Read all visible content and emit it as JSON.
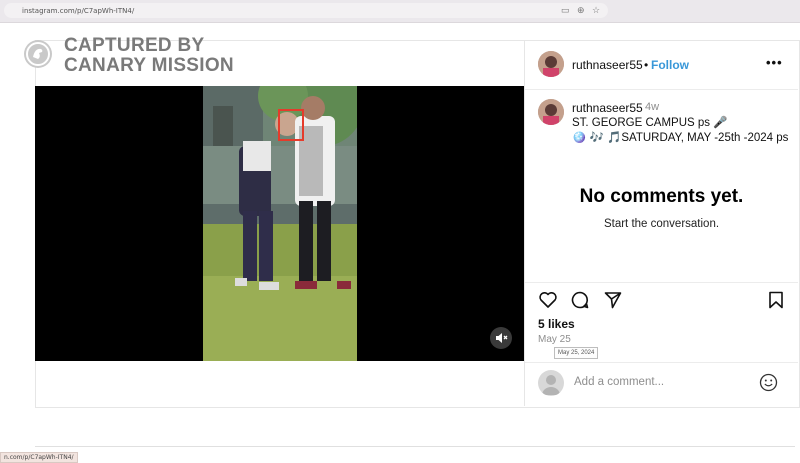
{
  "browser": {
    "url": "instagram.com/p/C7apWh-ITN4/",
    "status_url": "n.com/p/C7apWh-ITN4/"
  },
  "watermark": {
    "text": "CAPTURED BY\nCANARY MISSION"
  },
  "post": {
    "username": "ruthnaseer55",
    "separator": "•",
    "follow_label": "Follow",
    "more_label": "•••",
    "caption": {
      "username": "ruthnaseer55",
      "age": "4w",
      "line1": "ST. GEORGE CAMPUS ps 🎤",
      "line2": "🪩 🎶 🎵SATURDAY, MAY -25th -2024 ps"
    },
    "comments": {
      "empty_title": "No comments yet.",
      "empty_subtitle": "Start the conversation."
    },
    "likes": "5 likes",
    "date": "May 25",
    "date_tooltip": "May 25, 2024",
    "comment_placeholder": "Add a comment..."
  },
  "icons": {
    "like": "heart-icon",
    "comment": "comment-bubble-icon",
    "share": "paper-plane-icon",
    "save": "bookmark-icon",
    "mute": "muted-speaker-icon",
    "emoji": "smiley-icon"
  },
  "colors": {
    "follow": "#3897d8",
    "face_box": "#e53b2b"
  }
}
